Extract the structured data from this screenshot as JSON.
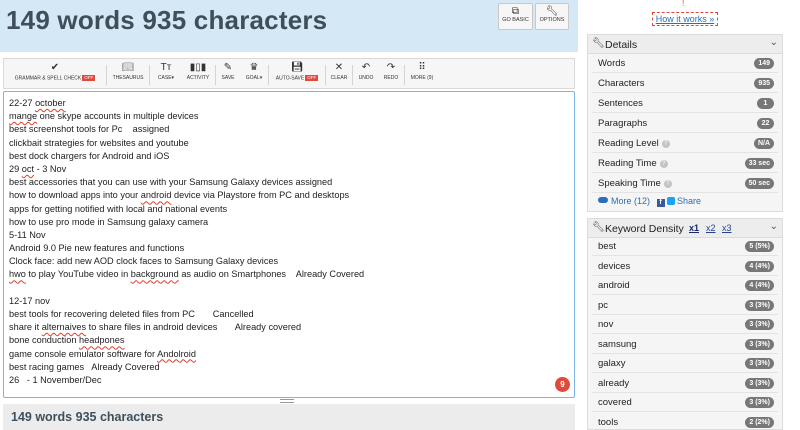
{
  "header": {
    "title": "149 words 935 characters",
    "buttons": [
      {
        "label": "GO BASIC",
        "icon": "external-link-icon"
      },
      {
        "label": "OPTIONS",
        "icon": "wrench-icon"
      }
    ]
  },
  "toolbar": {
    "grammar": {
      "label": "GRAMMAR & SPELL CHECK",
      "badge": "OFF"
    },
    "thesaurus": {
      "label": "THESAURUS"
    },
    "case": {
      "label": "CASE▾"
    },
    "activity": {
      "label": "ACTIVITY"
    },
    "save": {
      "label": "SAVE"
    },
    "goal": {
      "label": "GOAL▾"
    },
    "autosave": {
      "label": "AUTO-SAVE",
      "badge": "OFF"
    },
    "clear": {
      "label": "CLEAR"
    },
    "undo": {
      "label": "UNDO"
    },
    "redo": {
      "label": "REDO"
    },
    "more": {
      "label": "MORE (9)"
    }
  },
  "editor": {
    "error_count": "9",
    "lines": [
      [
        "22-27 ",
        {
          "sp": "october"
        }
      ],
      [
        {
          "sp": "mange"
        },
        " one skype accounts in multiple devices"
      ],
      [
        "best screenshot tools for Pc    assigned"
      ],
      [
        "clickbait strategies for websites and youtube"
      ],
      [
        "best dock chargers for Android and iOS"
      ],
      [
        "29 ",
        {
          "sp": "oct"
        },
        " - 3 Nov"
      ],
      [
        "best accessories that you can use with your Samsung Galaxy devices assigned"
      ],
      [
        "how to download apps into your ",
        {
          "sp": "android"
        },
        " device via Playstore from PC and desktops"
      ],
      [
        "apps for getting notified with local and national events"
      ],
      [
        "how to use pro mode in Samsung galaxy camera"
      ],
      [
        "5-11 Nov"
      ],
      [
        "Android 9.0 Pie new features and functions"
      ],
      [
        "Clock face: add new AOD clock faces to Samsung Galaxy devices"
      ],
      [
        {
          "sp": "hwo"
        },
        " to play YouTube video in ",
        {
          "sp": "background"
        },
        " as audio on Smartphones    Already Covered"
      ],
      [
        ""
      ],
      [
        "12-17 nov"
      ],
      [
        "best tools for recovering deleted files from PC       Cancelled"
      ],
      [
        "share it ",
        {
          "sp": "alternaives"
        },
        " to share files in android devices       Already covered"
      ],
      [
        "bone conduction ",
        {
          "sp": "headpones"
        }
      ],
      [
        "game console emulator software for ",
        {
          "sp": "Andolroid"
        }
      ],
      [
        "best racing games   Already Covered"
      ],
      [
        "26   - 1 November/Dec"
      ]
    ]
  },
  "footer": {
    "title": "149 words 935 characters"
  },
  "sidebar": {
    "warning_mark": "!",
    "how_it_works": "How it works »",
    "details": {
      "title": "Details",
      "rows": [
        {
          "label": "Words",
          "value": "149"
        },
        {
          "label": "Characters",
          "value": "935"
        },
        {
          "label": "Sentences",
          "value": "1"
        },
        {
          "label": "Paragraphs",
          "value": "22"
        },
        {
          "label": "Reading Level",
          "value": "N/A"
        },
        {
          "label": "Reading Time",
          "value": "33 sec"
        },
        {
          "label": "Speaking Time",
          "value": "50 sec"
        }
      ],
      "more": "More (12)",
      "share": "Share"
    },
    "keyword_density": {
      "title": "Keyword Density",
      "tabs": [
        "x1",
        "x2",
        "x3"
      ],
      "rows": [
        {
          "label": "best",
          "value": "5 (5%)"
        },
        {
          "label": "devices",
          "value": "4 (4%)"
        },
        {
          "label": "android",
          "value": "4 (4%)"
        },
        {
          "label": "pc",
          "value": "3 (3%)"
        },
        {
          "label": "nov",
          "value": "3 (3%)"
        },
        {
          "label": "samsung",
          "value": "3 (3%)"
        },
        {
          "label": "galaxy",
          "value": "3 (3%)"
        },
        {
          "label": "already",
          "value": "3 (3%)"
        },
        {
          "label": "covered",
          "value": "3 (3%)"
        },
        {
          "label": "tools",
          "value": "2 (2%)"
        }
      ]
    }
  }
}
